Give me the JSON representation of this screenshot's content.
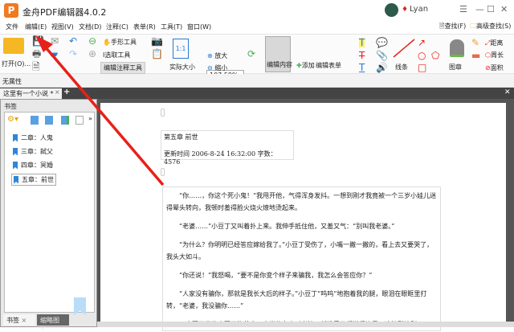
{
  "title": "金舟PDF编辑器4.0.2",
  "user": "Lyan",
  "menu": [
    "文件",
    "编辑(E)",
    "视图(V)",
    "文档(D)",
    "注释(C)",
    "表单(R)",
    "工具(T)",
    "窗口(W)"
  ],
  "search": {
    "find": "查找(F)",
    "advanced": "高级查找(S)"
  },
  "toolbar": {
    "open": "打开(O)...",
    "hand": "手形工具",
    "select": "选取工具",
    "edit_annot": "编辑注释工具",
    "actual": "实际大小",
    "zoom_value": "107.59%",
    "zoom_in": "放大",
    "zoom_out": "缩小",
    "edit_content": "编辑内容",
    "add": "添加",
    "edit_form": "编辑表单",
    "lines": "线条",
    "stamp": "图章",
    "distance": "距离",
    "perimeter": "周长",
    "area": "面积"
  },
  "props": "无属性",
  "doc_tab": "这里有一个小说 *",
  "panel": {
    "title": "书签",
    "items": [
      "二章：人鬼",
      "三章：弑父",
      "四章：冥婚",
      "五章：前世"
    ],
    "tabs": [
      "书签",
      "缩略图"
    ]
  },
  "doc": {
    "chapter": "第五章  前世",
    "meta": "更新时间 2006-8-24 16:32:00    字数：4576",
    "paragraphs": [
      "“你……，你这个死小鬼！”我甩开他，气得浑身发抖。一想到刚才我竟被一个三岁小娃儿迷得晕头转向，我顿时羞得脸火烧火燎地烫起来。",
      "“老婆……”小豆丁又叫着扑上来。我伸手抵住他，又羞又气：“别叫我老婆。”",
      "“为什么？你明明已经答应嫁给我了。”小豆丁受伤了，小嘴一撇一撇的，看上去又要哭了，我头大如斗。",
      "“你还说！”我怒喝，“要不是你变个样子来骗我，我怎么会答应你？”",
      "“人家没有骗你，那就是我长大后的样子。”小豆丁“呜呜”地抱着我的腿，眼泪在眼眶里打转，“老婆，我没骗你……”",
      "一个两三岁的小豆丁抱着个二十岁的女人叫老婆，任谁看了都觉得诡异，这情形让别"
    ]
  },
  "colors": {
    "accent": "#f07b1f",
    "arrow": "#e8201a"
  }
}
